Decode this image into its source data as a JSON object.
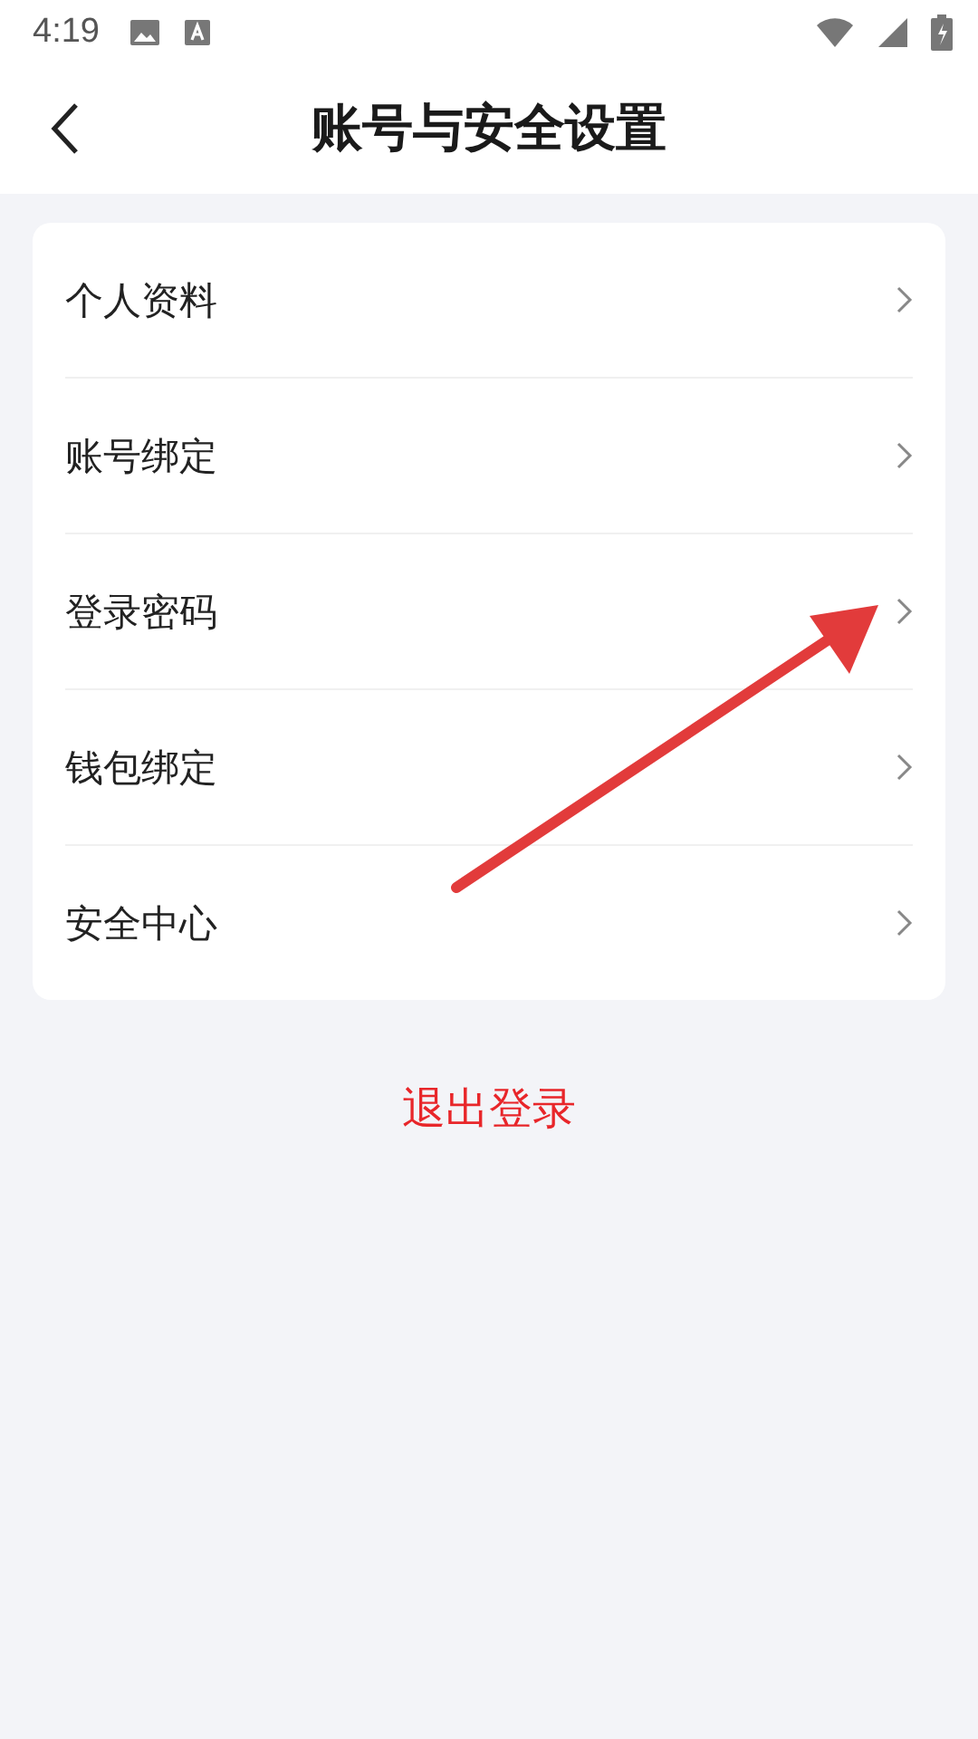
{
  "status_bar": {
    "time": "4:19"
  },
  "header": {
    "title": "账号与安全设置"
  },
  "menu": [
    {
      "label": "个人资料"
    },
    {
      "label": "账号绑定"
    },
    {
      "label": "登录密码"
    },
    {
      "label": "钱包绑定"
    },
    {
      "label": "安全中心"
    }
  ],
  "logout": {
    "label": "退出登录"
  }
}
